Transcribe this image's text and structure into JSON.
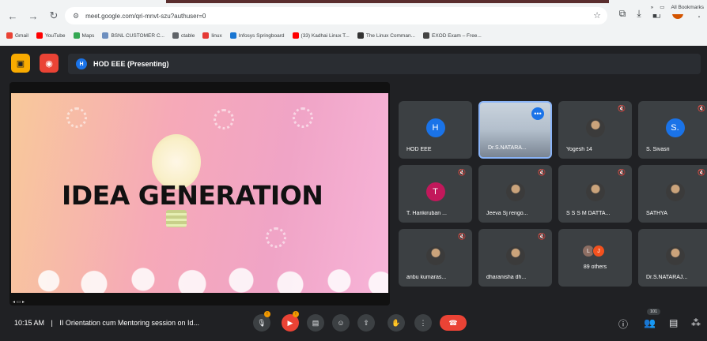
{
  "browser": {
    "url": "meet.google.com/qri-mnvt-szu?authuser=0",
    "bookmarks": [
      {
        "label": "Gmail",
        "color": "#ea4335"
      },
      {
        "label": "YouTube",
        "color": "#ff0000"
      },
      {
        "label": "Maps",
        "color": "#34a853"
      },
      {
        "label": "BSNL CUSTOMER C...",
        "color": "#6d8fbf"
      },
      {
        "label": "ctable",
        "color": "#5f6368"
      },
      {
        "label": "linux",
        "color": "#e53935"
      },
      {
        "label": "Infosys Springboard",
        "color": "#1976d2"
      },
      {
        "label": "(33) Kadhai Linux T...",
        "color": "#ff0000"
      },
      {
        "label": "The Linux Comman...",
        "color": "#333333"
      },
      {
        "label": "EXOD Exam – Free...",
        "color": "#444444"
      }
    ],
    "all_bookmarks": "All Bookmarks"
  },
  "meet": {
    "presenter_initial": "H",
    "presenting_label": "HOD EEE (Presenting)",
    "slide_title": "IDEA GENERATION",
    "tiles": [
      {
        "name": "HOD EEE",
        "initial": "H",
        "kind": "avatar",
        "color": "#1a73e8",
        "muted": false
      },
      {
        "name": "Dr.S.NATARA...",
        "kind": "video",
        "muted": false
      },
      {
        "name": "Yogesh 14",
        "kind": "photo",
        "muted": true
      },
      {
        "name": "S. Sivasri",
        "initial": "S.",
        "kind": "avatar",
        "color": "#1a73e8",
        "muted": true
      },
      {
        "name": "T. Harikiruban ...",
        "initial": "T",
        "kind": "avatar",
        "color": "#c2185b",
        "muted": true
      },
      {
        "name": "Jeeva Sj rengo...",
        "kind": "photo",
        "muted": true
      },
      {
        "name": "S S S M DATTA...",
        "kind": "photo",
        "muted": true
      },
      {
        "name": "SATHYA",
        "kind": "photo",
        "muted": true
      },
      {
        "name": "anbu kumaras...",
        "kind": "photo",
        "muted": true
      },
      {
        "name": "dharanisha dh...",
        "kind": "photo",
        "muted": true
      },
      {
        "name": "89 others",
        "kind": "others",
        "initials": [
          "L",
          "J"
        ],
        "muted": false
      },
      {
        "name": "Dr.S.NATARAJ...",
        "kind": "photo",
        "muted": false
      }
    ]
  },
  "bottom_bar": {
    "time": "10:15 AM",
    "separator": "|",
    "meeting_title": "II Orientation cum Mentoring session on Id...",
    "participant_count": "101"
  }
}
